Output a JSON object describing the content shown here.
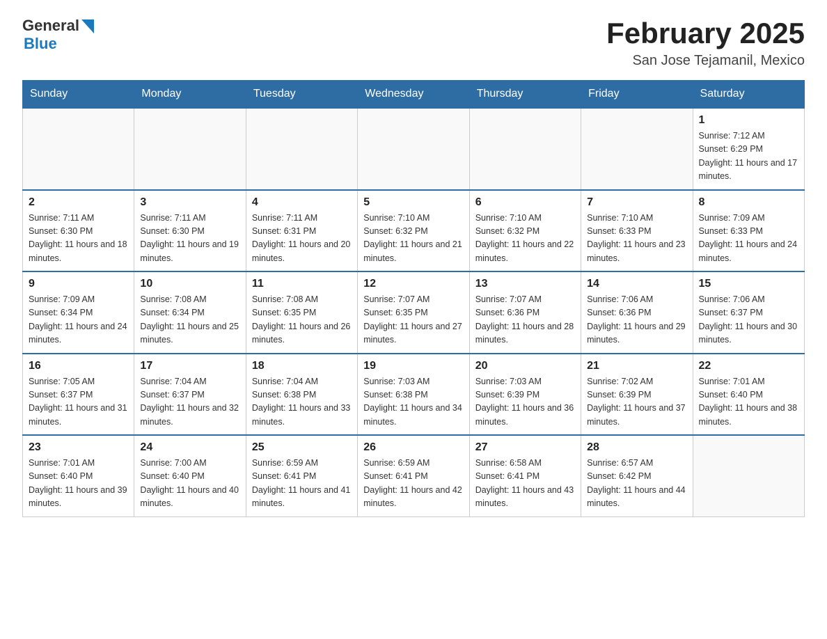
{
  "header": {
    "logo_general": "General",
    "logo_blue": "Blue",
    "month_title": "February 2025",
    "location": "San Jose Tejamanil, Mexico"
  },
  "days_of_week": [
    "Sunday",
    "Monday",
    "Tuesday",
    "Wednesday",
    "Thursday",
    "Friday",
    "Saturday"
  ],
  "weeks": [
    [
      {
        "day": "",
        "sunrise": "",
        "sunset": "",
        "daylight": ""
      },
      {
        "day": "",
        "sunrise": "",
        "sunset": "",
        "daylight": ""
      },
      {
        "day": "",
        "sunrise": "",
        "sunset": "",
        "daylight": ""
      },
      {
        "day": "",
        "sunrise": "",
        "sunset": "",
        "daylight": ""
      },
      {
        "day": "",
        "sunrise": "",
        "sunset": "",
        "daylight": ""
      },
      {
        "day": "",
        "sunrise": "",
        "sunset": "",
        "daylight": ""
      },
      {
        "day": "1",
        "sunrise": "Sunrise: 7:12 AM",
        "sunset": "Sunset: 6:29 PM",
        "daylight": "Daylight: 11 hours and 17 minutes."
      }
    ],
    [
      {
        "day": "2",
        "sunrise": "Sunrise: 7:11 AM",
        "sunset": "Sunset: 6:30 PM",
        "daylight": "Daylight: 11 hours and 18 minutes."
      },
      {
        "day": "3",
        "sunrise": "Sunrise: 7:11 AM",
        "sunset": "Sunset: 6:30 PM",
        "daylight": "Daylight: 11 hours and 19 minutes."
      },
      {
        "day": "4",
        "sunrise": "Sunrise: 7:11 AM",
        "sunset": "Sunset: 6:31 PM",
        "daylight": "Daylight: 11 hours and 20 minutes."
      },
      {
        "day": "5",
        "sunrise": "Sunrise: 7:10 AM",
        "sunset": "Sunset: 6:32 PM",
        "daylight": "Daylight: 11 hours and 21 minutes."
      },
      {
        "day": "6",
        "sunrise": "Sunrise: 7:10 AM",
        "sunset": "Sunset: 6:32 PM",
        "daylight": "Daylight: 11 hours and 22 minutes."
      },
      {
        "day": "7",
        "sunrise": "Sunrise: 7:10 AM",
        "sunset": "Sunset: 6:33 PM",
        "daylight": "Daylight: 11 hours and 23 minutes."
      },
      {
        "day": "8",
        "sunrise": "Sunrise: 7:09 AM",
        "sunset": "Sunset: 6:33 PM",
        "daylight": "Daylight: 11 hours and 24 minutes."
      }
    ],
    [
      {
        "day": "9",
        "sunrise": "Sunrise: 7:09 AM",
        "sunset": "Sunset: 6:34 PM",
        "daylight": "Daylight: 11 hours and 24 minutes."
      },
      {
        "day": "10",
        "sunrise": "Sunrise: 7:08 AM",
        "sunset": "Sunset: 6:34 PM",
        "daylight": "Daylight: 11 hours and 25 minutes."
      },
      {
        "day": "11",
        "sunrise": "Sunrise: 7:08 AM",
        "sunset": "Sunset: 6:35 PM",
        "daylight": "Daylight: 11 hours and 26 minutes."
      },
      {
        "day": "12",
        "sunrise": "Sunrise: 7:07 AM",
        "sunset": "Sunset: 6:35 PM",
        "daylight": "Daylight: 11 hours and 27 minutes."
      },
      {
        "day": "13",
        "sunrise": "Sunrise: 7:07 AM",
        "sunset": "Sunset: 6:36 PM",
        "daylight": "Daylight: 11 hours and 28 minutes."
      },
      {
        "day": "14",
        "sunrise": "Sunrise: 7:06 AM",
        "sunset": "Sunset: 6:36 PM",
        "daylight": "Daylight: 11 hours and 29 minutes."
      },
      {
        "day": "15",
        "sunrise": "Sunrise: 7:06 AM",
        "sunset": "Sunset: 6:37 PM",
        "daylight": "Daylight: 11 hours and 30 minutes."
      }
    ],
    [
      {
        "day": "16",
        "sunrise": "Sunrise: 7:05 AM",
        "sunset": "Sunset: 6:37 PM",
        "daylight": "Daylight: 11 hours and 31 minutes."
      },
      {
        "day": "17",
        "sunrise": "Sunrise: 7:04 AM",
        "sunset": "Sunset: 6:37 PM",
        "daylight": "Daylight: 11 hours and 32 minutes."
      },
      {
        "day": "18",
        "sunrise": "Sunrise: 7:04 AM",
        "sunset": "Sunset: 6:38 PM",
        "daylight": "Daylight: 11 hours and 33 minutes."
      },
      {
        "day": "19",
        "sunrise": "Sunrise: 7:03 AM",
        "sunset": "Sunset: 6:38 PM",
        "daylight": "Daylight: 11 hours and 34 minutes."
      },
      {
        "day": "20",
        "sunrise": "Sunrise: 7:03 AM",
        "sunset": "Sunset: 6:39 PM",
        "daylight": "Daylight: 11 hours and 36 minutes."
      },
      {
        "day": "21",
        "sunrise": "Sunrise: 7:02 AM",
        "sunset": "Sunset: 6:39 PM",
        "daylight": "Daylight: 11 hours and 37 minutes."
      },
      {
        "day": "22",
        "sunrise": "Sunrise: 7:01 AM",
        "sunset": "Sunset: 6:40 PM",
        "daylight": "Daylight: 11 hours and 38 minutes."
      }
    ],
    [
      {
        "day": "23",
        "sunrise": "Sunrise: 7:01 AM",
        "sunset": "Sunset: 6:40 PM",
        "daylight": "Daylight: 11 hours and 39 minutes."
      },
      {
        "day": "24",
        "sunrise": "Sunrise: 7:00 AM",
        "sunset": "Sunset: 6:40 PM",
        "daylight": "Daylight: 11 hours and 40 minutes."
      },
      {
        "day": "25",
        "sunrise": "Sunrise: 6:59 AM",
        "sunset": "Sunset: 6:41 PM",
        "daylight": "Daylight: 11 hours and 41 minutes."
      },
      {
        "day": "26",
        "sunrise": "Sunrise: 6:59 AM",
        "sunset": "Sunset: 6:41 PM",
        "daylight": "Daylight: 11 hours and 42 minutes."
      },
      {
        "day": "27",
        "sunrise": "Sunrise: 6:58 AM",
        "sunset": "Sunset: 6:41 PM",
        "daylight": "Daylight: 11 hours and 43 minutes."
      },
      {
        "day": "28",
        "sunrise": "Sunrise: 6:57 AM",
        "sunset": "Sunset: 6:42 PM",
        "daylight": "Daylight: 11 hours and 44 minutes."
      },
      {
        "day": "",
        "sunrise": "",
        "sunset": "",
        "daylight": ""
      }
    ]
  ]
}
